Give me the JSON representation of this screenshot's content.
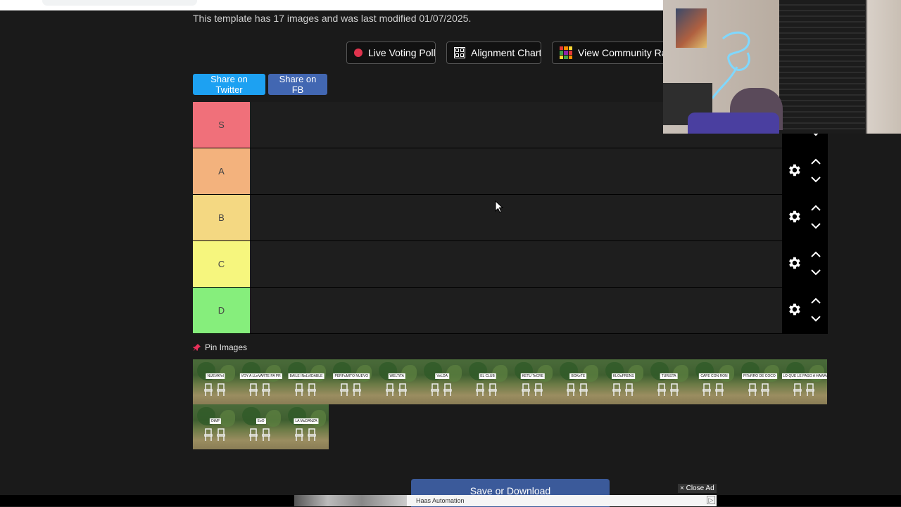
{
  "template_info": "This template has 17 images and was last modified 01/07/2025.",
  "action_buttons": {
    "live_voting": "Live Voting Poll",
    "alignment_chart": "Alignment Chart",
    "community_rank": "View Community Ran"
  },
  "share": {
    "twitter": "Share on Twitter",
    "facebook": "Share on FB"
  },
  "tiers": [
    {
      "label": "S",
      "color": "#f0707a"
    },
    {
      "label": "A",
      "color": "#f3b27d"
    },
    {
      "label": "B",
      "color": "#f4d882"
    },
    {
      "label": "C",
      "color": "#f6f67e"
    },
    {
      "label": "D",
      "color": "#86ee7c"
    }
  ],
  "pin_images_label": "Pin Images",
  "images": [
    "NUEVAYol",
    "VOY A LLeVARTE PA PR",
    "BAILE INoLVIDABLE",
    "PERFuMITO NUEVO",
    "WELTiTA",
    "VeLDA",
    "EL CLUB",
    "KETU TeCRE",
    "BOKeTE",
    "KLOuFRENS",
    "TURiSTA",
    "CAFE CON RON",
    "PIToRRO DE COCO",
    "LO QUE LE PASO A HAWAii",
    "DtMF",
    "EoO",
    "LA MuDANZA"
  ],
  "save_download": "Save or Download",
  "close_ad": "× Close Ad",
  "ad": {
    "advertiser": "Haas Automation",
    "badge": "▷"
  },
  "colors": {
    "twitter": "#1da1f2",
    "facebook": "#4267b2",
    "save": "#3b5a9a"
  }
}
